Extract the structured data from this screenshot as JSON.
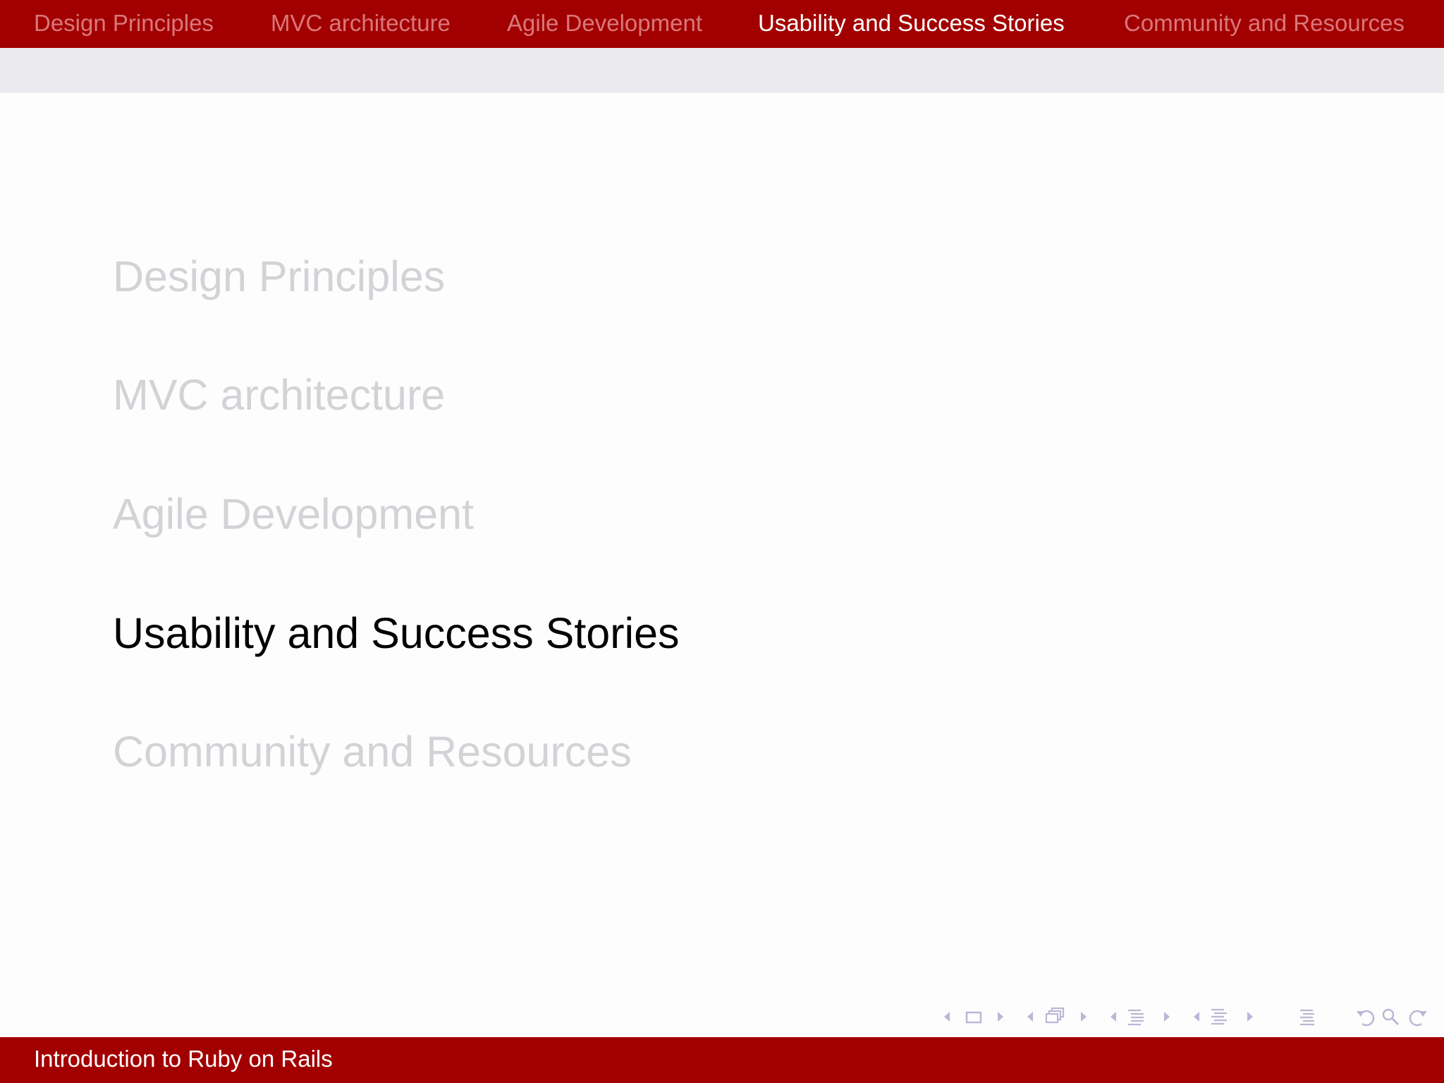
{
  "header": {
    "sections": [
      {
        "label": "Design Principles",
        "active": false
      },
      {
        "label": "MVC architecture",
        "active": false
      },
      {
        "label": "Agile Development",
        "active": false
      },
      {
        "label": "Usability and Success Stories",
        "active": true
      },
      {
        "label": "Community and Resources",
        "active": false
      }
    ]
  },
  "toc": {
    "items": [
      {
        "label": "Design Principles",
        "active": false
      },
      {
        "label": "MVC architecture",
        "active": false
      },
      {
        "label": "Agile Development",
        "active": false
      },
      {
        "label": "Usability and Success Stories",
        "active": true
      },
      {
        "label": "Community and Resources",
        "active": false
      }
    ]
  },
  "navigation": {
    "icons": [
      "prev-frame-icon",
      "frame-icon",
      "next-frame-icon",
      "prev-subsection-icon",
      "subsection-icon",
      "next-subsection-icon",
      "prev-section-icon",
      "section-icon",
      "next-section-icon",
      "prev-document-icon",
      "document-icon",
      "next-document-icon",
      "toc-icon",
      "undo-icon",
      "search-icon",
      "redo-icon"
    ],
    "icon_color": "#b8b8d6"
  },
  "footer": {
    "title": "Introduction to Ruby on Rails"
  },
  "colors": {
    "bar": "#a20000",
    "inactive_nav": "#d9777a",
    "active_nav": "#ffffff",
    "inactive_toc": "#d4d2d6",
    "active_toc": "#000000",
    "subbar": "#ebeaee"
  }
}
